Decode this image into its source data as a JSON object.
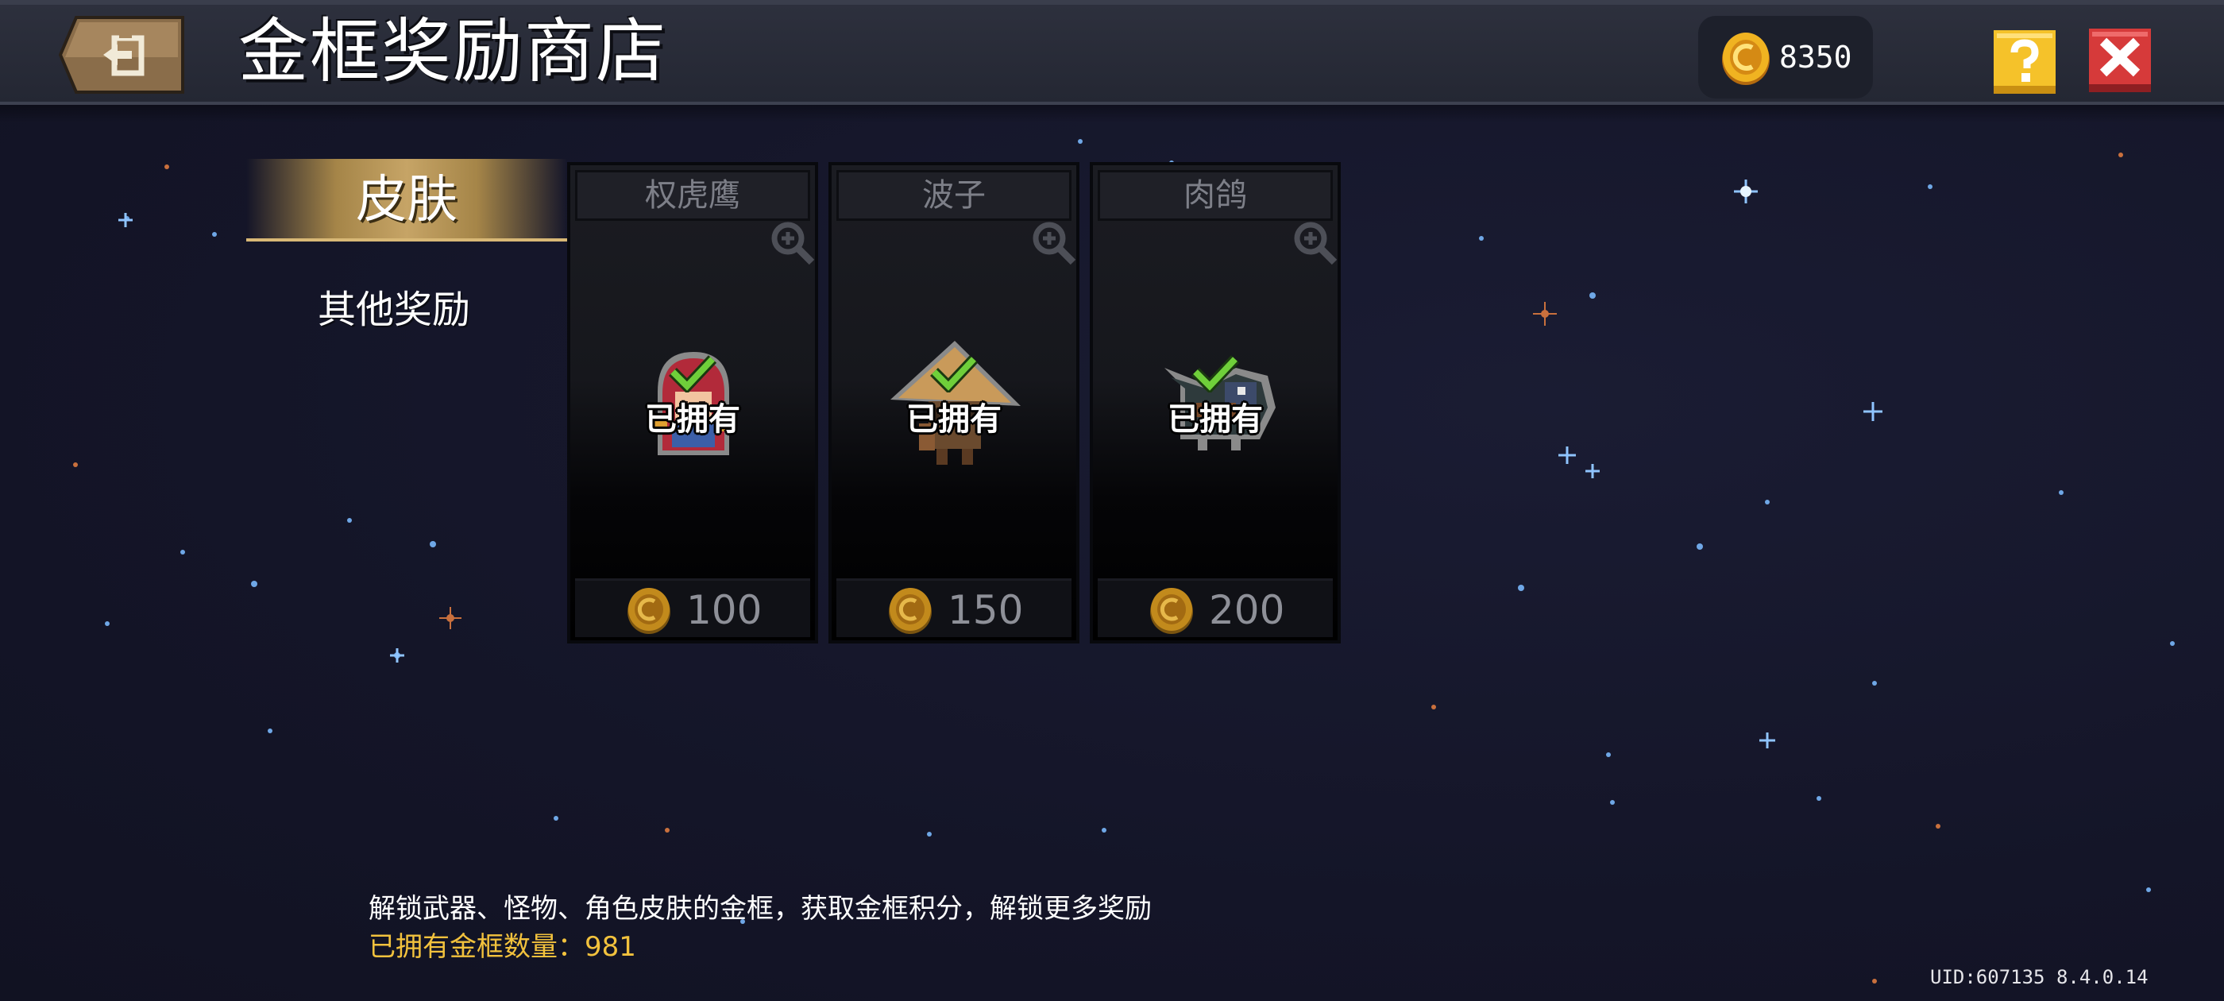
{
  "header": {
    "title": "金框奖励商店",
    "back_icon": "exit-door-icon",
    "coins": "8350",
    "coin_icon": "gold-coin-icon",
    "help_icon": "question-mark-icon",
    "close_icon": "close-x-icon"
  },
  "categories": {
    "active": "皮肤",
    "other": "其他奖励"
  },
  "items": [
    {
      "name": "权虎鹰",
      "status": "已拥有",
      "price": "100",
      "art": "red-hooded-hero-skin"
    },
    {
      "name": "波子",
      "status": "已拥有",
      "price": "150",
      "art": "straw-hat-wanderer-skin"
    },
    {
      "name": "肉鸽",
      "status": "已拥有",
      "price": "200",
      "art": "pigeon-knight-skin"
    }
  ],
  "footer": {
    "description": "解锁武器、怪物、角色皮肤的金框，获取金框积分，解锁更多奖励",
    "owned_count": "已拥有金框数量：981"
  },
  "uid": "UID:607135 8.4.0.14",
  "colors": {
    "background": "#151628",
    "top_bar": "#2b2e3a",
    "tab_gold": "#c6a466",
    "coin_gold": "#e8a81c",
    "help_yellow": "#f5c22a",
    "close_red": "#d63a3a",
    "owned_check_green": "#6fcf3a",
    "owned_count_text": "#f2c23d"
  }
}
